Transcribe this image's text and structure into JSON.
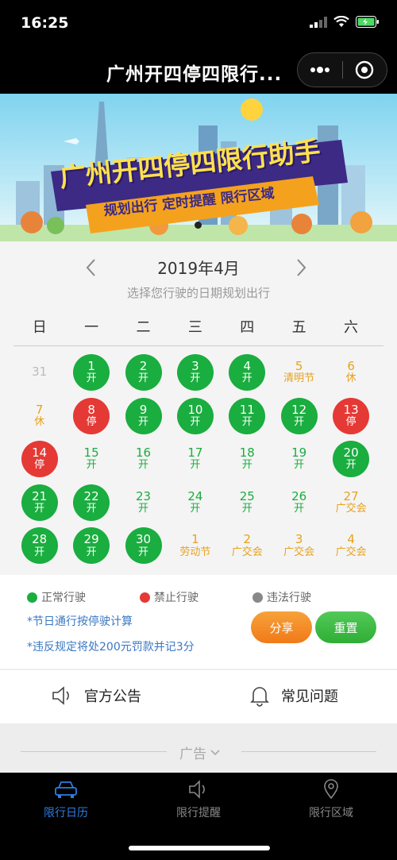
{
  "status_bar": {
    "time": "16:25"
  },
  "nav": {
    "title": "广州开四停四限行..."
  },
  "banner": {
    "title": "广州开四停四限行助手",
    "tags": "规划出行 定时提醒 限行区域"
  },
  "calendar": {
    "month": "2019年4月",
    "hint": "选择您行驶的日期规划出行",
    "weekdays": [
      "日",
      "一",
      "二",
      "三",
      "四",
      "五",
      "六"
    ],
    "days": [
      {
        "d": "31",
        "s": "",
        "t": "plain-gray"
      },
      {
        "d": "1",
        "s": "开",
        "t": "green"
      },
      {
        "d": "2",
        "s": "开",
        "t": "green"
      },
      {
        "d": "3",
        "s": "开",
        "t": "green"
      },
      {
        "d": "4",
        "s": "开",
        "t": "green"
      },
      {
        "d": "5",
        "s": "清明节",
        "t": "plain-orange"
      },
      {
        "d": "6",
        "s": "休",
        "t": "plain-orange"
      },
      {
        "d": "7",
        "s": "休",
        "t": "plain-orange"
      },
      {
        "d": "8",
        "s": "停",
        "t": "red"
      },
      {
        "d": "9",
        "s": "开",
        "t": "green"
      },
      {
        "d": "10",
        "s": "开",
        "t": "green"
      },
      {
        "d": "11",
        "s": "开",
        "t": "green"
      },
      {
        "d": "12",
        "s": "开",
        "t": "green"
      },
      {
        "d": "13",
        "s": "停",
        "t": "red"
      },
      {
        "d": "14",
        "s": "停",
        "t": "red"
      },
      {
        "d": "15",
        "s": "开",
        "t": "plain-green"
      },
      {
        "d": "16",
        "s": "开",
        "t": "plain-green"
      },
      {
        "d": "17",
        "s": "开",
        "t": "plain-green"
      },
      {
        "d": "18",
        "s": "开",
        "t": "plain-green"
      },
      {
        "d": "19",
        "s": "开",
        "t": "plain-green"
      },
      {
        "d": "20",
        "s": "开",
        "t": "green"
      },
      {
        "d": "21",
        "s": "开",
        "t": "green"
      },
      {
        "d": "22",
        "s": "开",
        "t": "green"
      },
      {
        "d": "23",
        "s": "开",
        "t": "plain-green"
      },
      {
        "d": "24",
        "s": "开",
        "t": "plain-green"
      },
      {
        "d": "25",
        "s": "开",
        "t": "plain-green"
      },
      {
        "d": "26",
        "s": "开",
        "t": "plain-green"
      },
      {
        "d": "27",
        "s": "广交会",
        "t": "plain-orange"
      },
      {
        "d": "28",
        "s": "开",
        "t": "green"
      },
      {
        "d": "29",
        "s": "开",
        "t": "green"
      },
      {
        "d": "30",
        "s": "开",
        "t": "green"
      },
      {
        "d": "1",
        "s": "劳动节",
        "t": "plain-orange"
      },
      {
        "d": "2",
        "s": "广交会",
        "t": "plain-orange"
      },
      {
        "d": "3",
        "s": "广交会",
        "t": "plain-orange"
      },
      {
        "d": "4",
        "s": "广交会",
        "t": "plain-orange"
      }
    ]
  },
  "legend": {
    "normal": "正常行驶",
    "forbidden": "禁止行驶",
    "illegal": "违法行驶",
    "note1": "*节日通行按停驶计算",
    "note2": "*违反规定将处200元罚款并记3分",
    "share": "分享",
    "reset": "重置"
  },
  "links": {
    "announcement": "官方公告",
    "faq": "常见问题"
  },
  "ad": {
    "label": "广告"
  },
  "tabs": {
    "calendar": "限行日历",
    "reminder": "限行提醒",
    "area": "限行区域"
  },
  "colors": {
    "green": "#1aad3f",
    "red": "#e53935",
    "orange": "#e8a21a",
    "active_tab": "#2d7ee0"
  }
}
